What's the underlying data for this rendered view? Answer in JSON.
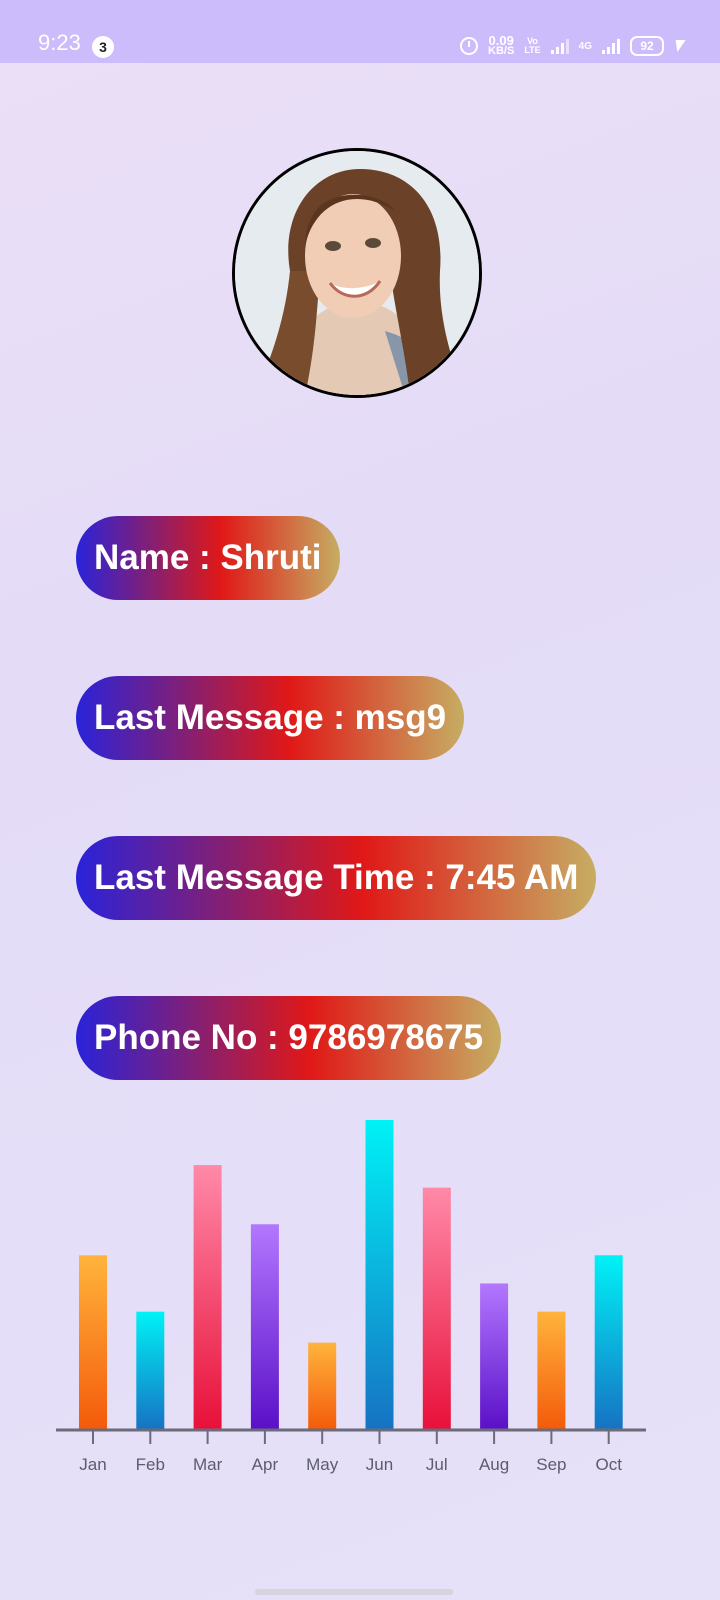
{
  "status_bar": {
    "time": "9:23",
    "notification_count": "3",
    "net_speed_value": "0.09",
    "net_speed_unit": "KB/S",
    "volte_top": "Vo",
    "volte_bottom": "LTE",
    "network_type": "4G",
    "battery_level": "92"
  },
  "profile": {
    "avatar_icon": "profile-photo",
    "name_label": "Name : Shruti",
    "last_message_label": "Last Message : msg9",
    "last_message_time_label": "Last Message Time : 7:45 AM",
    "phone_label": "Phone No : 9786978675"
  },
  "chart_data": {
    "type": "bar",
    "categories": [
      "Jan",
      "Feb",
      "Mar",
      "Apr",
      "May",
      "Jun",
      "Jul",
      "Aug",
      "Sep",
      "Oct"
    ],
    "values": [
      62,
      42,
      94,
      73,
      31,
      110,
      86,
      52,
      42,
      62
    ],
    "ylim": [
      0,
      110
    ],
    "grid": false,
    "colors": [
      [
        "#ffb43c",
        "#f45a0a"
      ],
      [
        "#00f2f6",
        "#1672c3"
      ],
      [
        "#ff89a8",
        "#e8103a"
      ],
      [
        "#b377ff",
        "#5a10c7"
      ],
      [
        "#ffb43c",
        "#f45a0a"
      ],
      [
        "#00f2f6",
        "#1672c3"
      ],
      [
        "#ff89a8",
        "#e8103a"
      ],
      [
        "#b377ff",
        "#5a10c7"
      ],
      [
        "#ffb43c",
        "#f45a0a"
      ],
      [
        "#00f2f6",
        "#1672c3"
      ]
    ]
  }
}
